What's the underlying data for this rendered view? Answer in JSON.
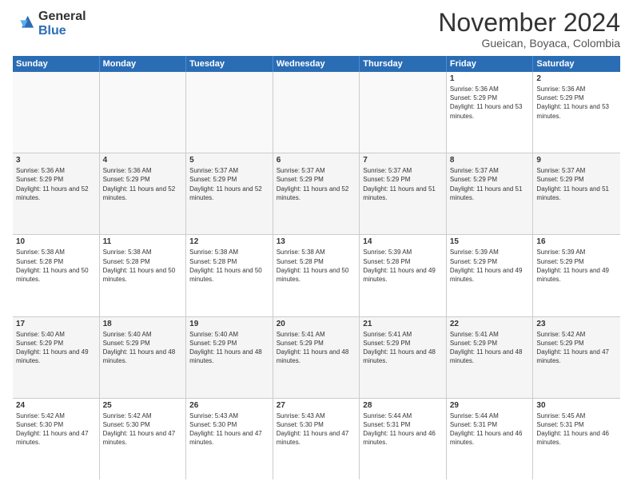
{
  "logo": {
    "general": "General",
    "blue": "Blue"
  },
  "title": "November 2024",
  "location": "Gueican, Boyaca, Colombia",
  "weekdays": [
    "Sunday",
    "Monday",
    "Tuesday",
    "Wednesday",
    "Thursday",
    "Friday",
    "Saturday"
  ],
  "weeks": [
    [
      {
        "day": "",
        "sunrise": "",
        "sunset": "",
        "daylight": "",
        "empty": true
      },
      {
        "day": "",
        "sunrise": "",
        "sunset": "",
        "daylight": "",
        "empty": true
      },
      {
        "day": "",
        "sunrise": "",
        "sunset": "",
        "daylight": "",
        "empty": true
      },
      {
        "day": "",
        "sunrise": "",
        "sunset": "",
        "daylight": "",
        "empty": true
      },
      {
        "day": "",
        "sunrise": "",
        "sunset": "",
        "daylight": "",
        "empty": true
      },
      {
        "day": "1",
        "sunrise": "Sunrise: 5:36 AM",
        "sunset": "Sunset: 5:29 PM",
        "daylight": "Daylight: 11 hours and 53 minutes.",
        "empty": false
      },
      {
        "day": "2",
        "sunrise": "Sunrise: 5:36 AM",
        "sunset": "Sunset: 5:29 PM",
        "daylight": "Daylight: 11 hours and 53 minutes.",
        "empty": false
      }
    ],
    [
      {
        "day": "3",
        "sunrise": "Sunrise: 5:36 AM",
        "sunset": "Sunset: 5:29 PM",
        "daylight": "Daylight: 11 hours and 52 minutes.",
        "empty": false
      },
      {
        "day": "4",
        "sunrise": "Sunrise: 5:36 AM",
        "sunset": "Sunset: 5:29 PM",
        "daylight": "Daylight: 11 hours and 52 minutes.",
        "empty": false
      },
      {
        "day": "5",
        "sunrise": "Sunrise: 5:37 AM",
        "sunset": "Sunset: 5:29 PM",
        "daylight": "Daylight: 11 hours and 52 minutes.",
        "empty": false
      },
      {
        "day": "6",
        "sunrise": "Sunrise: 5:37 AM",
        "sunset": "Sunset: 5:29 PM",
        "daylight": "Daylight: 11 hours and 52 minutes.",
        "empty": false
      },
      {
        "day": "7",
        "sunrise": "Sunrise: 5:37 AM",
        "sunset": "Sunset: 5:29 PM",
        "daylight": "Daylight: 11 hours and 51 minutes.",
        "empty": false
      },
      {
        "day": "8",
        "sunrise": "Sunrise: 5:37 AM",
        "sunset": "Sunset: 5:29 PM",
        "daylight": "Daylight: 11 hours and 51 minutes.",
        "empty": false
      },
      {
        "day": "9",
        "sunrise": "Sunrise: 5:37 AM",
        "sunset": "Sunset: 5:29 PM",
        "daylight": "Daylight: 11 hours and 51 minutes.",
        "empty": false
      }
    ],
    [
      {
        "day": "10",
        "sunrise": "Sunrise: 5:38 AM",
        "sunset": "Sunset: 5:28 PM",
        "daylight": "Daylight: 11 hours and 50 minutes.",
        "empty": false
      },
      {
        "day": "11",
        "sunrise": "Sunrise: 5:38 AM",
        "sunset": "Sunset: 5:28 PM",
        "daylight": "Daylight: 11 hours and 50 minutes.",
        "empty": false
      },
      {
        "day": "12",
        "sunrise": "Sunrise: 5:38 AM",
        "sunset": "Sunset: 5:28 PM",
        "daylight": "Daylight: 11 hours and 50 minutes.",
        "empty": false
      },
      {
        "day": "13",
        "sunrise": "Sunrise: 5:38 AM",
        "sunset": "Sunset: 5:28 PM",
        "daylight": "Daylight: 11 hours and 50 minutes.",
        "empty": false
      },
      {
        "day": "14",
        "sunrise": "Sunrise: 5:39 AM",
        "sunset": "Sunset: 5:28 PM",
        "daylight": "Daylight: 11 hours and 49 minutes.",
        "empty": false
      },
      {
        "day": "15",
        "sunrise": "Sunrise: 5:39 AM",
        "sunset": "Sunset: 5:29 PM",
        "daylight": "Daylight: 11 hours and 49 minutes.",
        "empty": false
      },
      {
        "day": "16",
        "sunrise": "Sunrise: 5:39 AM",
        "sunset": "Sunset: 5:29 PM",
        "daylight": "Daylight: 11 hours and 49 minutes.",
        "empty": false
      }
    ],
    [
      {
        "day": "17",
        "sunrise": "Sunrise: 5:40 AM",
        "sunset": "Sunset: 5:29 PM",
        "daylight": "Daylight: 11 hours and 49 minutes.",
        "empty": false
      },
      {
        "day": "18",
        "sunrise": "Sunrise: 5:40 AM",
        "sunset": "Sunset: 5:29 PM",
        "daylight": "Daylight: 11 hours and 48 minutes.",
        "empty": false
      },
      {
        "day": "19",
        "sunrise": "Sunrise: 5:40 AM",
        "sunset": "Sunset: 5:29 PM",
        "daylight": "Daylight: 11 hours and 48 minutes.",
        "empty": false
      },
      {
        "day": "20",
        "sunrise": "Sunrise: 5:41 AM",
        "sunset": "Sunset: 5:29 PM",
        "daylight": "Daylight: 11 hours and 48 minutes.",
        "empty": false
      },
      {
        "day": "21",
        "sunrise": "Sunrise: 5:41 AM",
        "sunset": "Sunset: 5:29 PM",
        "daylight": "Daylight: 11 hours and 48 minutes.",
        "empty": false
      },
      {
        "day": "22",
        "sunrise": "Sunrise: 5:41 AM",
        "sunset": "Sunset: 5:29 PM",
        "daylight": "Daylight: 11 hours and 48 minutes.",
        "empty": false
      },
      {
        "day": "23",
        "sunrise": "Sunrise: 5:42 AM",
        "sunset": "Sunset: 5:29 PM",
        "daylight": "Daylight: 11 hours and 47 minutes.",
        "empty": false
      }
    ],
    [
      {
        "day": "24",
        "sunrise": "Sunrise: 5:42 AM",
        "sunset": "Sunset: 5:30 PM",
        "daylight": "Daylight: 11 hours and 47 minutes.",
        "empty": false
      },
      {
        "day": "25",
        "sunrise": "Sunrise: 5:42 AM",
        "sunset": "Sunset: 5:30 PM",
        "daylight": "Daylight: 11 hours and 47 minutes.",
        "empty": false
      },
      {
        "day": "26",
        "sunrise": "Sunrise: 5:43 AM",
        "sunset": "Sunset: 5:30 PM",
        "daylight": "Daylight: 11 hours and 47 minutes.",
        "empty": false
      },
      {
        "day": "27",
        "sunrise": "Sunrise: 5:43 AM",
        "sunset": "Sunset: 5:30 PM",
        "daylight": "Daylight: 11 hours and 47 minutes.",
        "empty": false
      },
      {
        "day": "28",
        "sunrise": "Sunrise: 5:44 AM",
        "sunset": "Sunset: 5:31 PM",
        "daylight": "Daylight: 11 hours and 46 minutes.",
        "empty": false
      },
      {
        "day": "29",
        "sunrise": "Sunrise: 5:44 AM",
        "sunset": "Sunset: 5:31 PM",
        "daylight": "Daylight: 11 hours and 46 minutes.",
        "empty": false
      },
      {
        "day": "30",
        "sunrise": "Sunrise: 5:45 AM",
        "sunset": "Sunset: 5:31 PM",
        "daylight": "Daylight: 11 hours and 46 minutes.",
        "empty": false
      }
    ]
  ]
}
